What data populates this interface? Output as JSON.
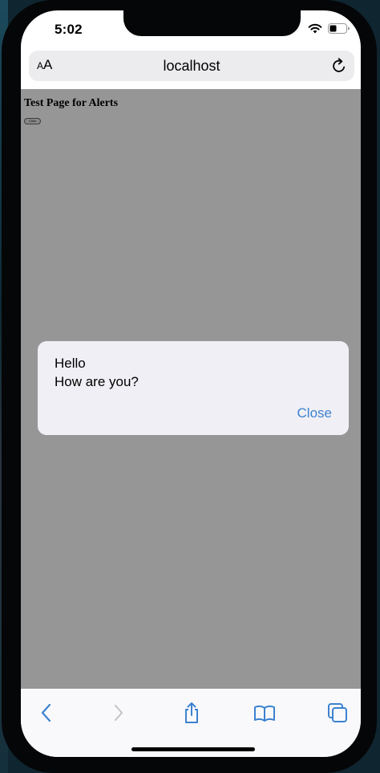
{
  "status_bar": {
    "time": "5:02"
  },
  "url_bar": {
    "text_size_label_small": "A",
    "text_size_label_large": "A",
    "url": "localhost"
  },
  "page": {
    "heading": "Test Page for Alerts",
    "button_label": "Click"
  },
  "alert": {
    "line1": "Hello",
    "line2": "How are you?",
    "close_label": "Close"
  },
  "toolbar": {
    "items": [
      "back-icon",
      "forward-icon",
      "share-icon",
      "bookmarks-icon",
      "tabs-icon"
    ]
  },
  "colors": {
    "accent": "#3c82d0",
    "overlay": "#969696",
    "alert_bg": "#f0eff5"
  }
}
